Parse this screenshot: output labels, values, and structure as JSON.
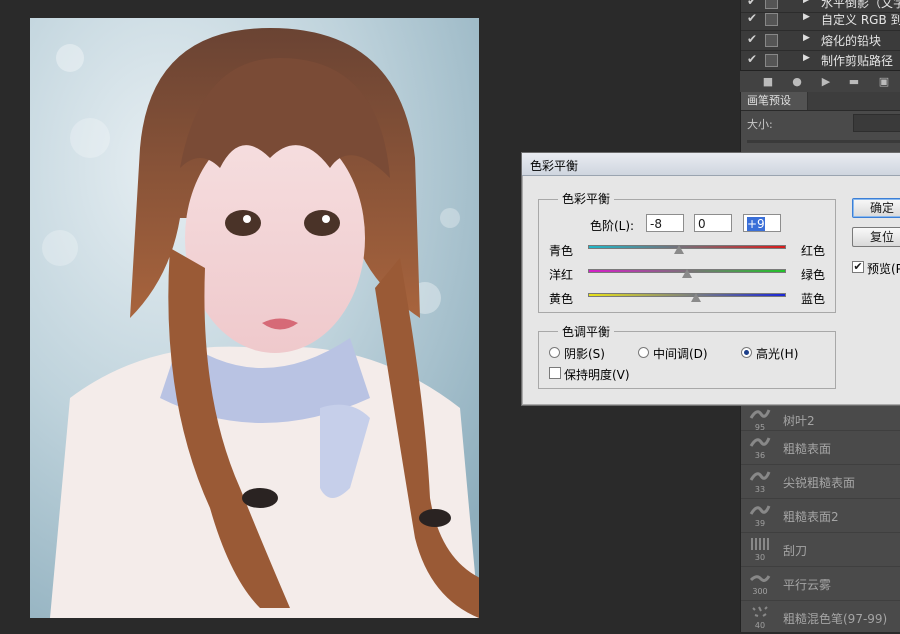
{
  "actions": {
    "rows": [
      {
        "label": "水平倒影（文字",
        "checked": true
      },
      {
        "label": "自定义 RGB 到灰度",
        "checked": true
      },
      {
        "label": "熔化的铅块",
        "checked": true
      },
      {
        "label": "制作剪贴路径",
        "checked": true
      }
    ]
  },
  "brush_panel": {
    "tab": "画笔预设",
    "size_label": "大小:",
    "items": [
      {
        "num": "95",
        "name": "树叶2"
      },
      {
        "num": "36",
        "name": "粗糙表面"
      },
      {
        "num": "33",
        "name": "尖锐粗糙表面"
      },
      {
        "num": "39",
        "name": "粗糙表面2"
      },
      {
        "num": "30",
        "name": "刮刀"
      },
      {
        "num": "300",
        "name": "平行云雾"
      },
      {
        "num": "40",
        "name": "粗糙混色笔(97-99)"
      }
    ]
  },
  "dialog": {
    "title": "色彩平衡",
    "color_balance": {
      "group_title": "色彩平衡",
      "levels_label": "色阶(L):",
      "levels": [
        "-8",
        "0",
        "+9"
      ],
      "sliders": [
        {
          "left": "青色",
          "right": "红色",
          "value": -8,
          "colors": [
            "#1fb7c9",
            "#d91c1c"
          ]
        },
        {
          "left": "洋红",
          "right": "绿色",
          "value": 0,
          "colors": [
            "#d51fc8",
            "#22c22a"
          ]
        },
        {
          "left": "黄色",
          "right": "蓝色",
          "value": 9,
          "colors": [
            "#e8e21a",
            "#1a27d8"
          ]
        }
      ]
    },
    "tone_balance": {
      "group_title": "色调平衡",
      "options": [
        "阴影(S)",
        "中间调(D)",
        "高光(H)"
      ],
      "selected": "高光(H)",
      "preserve_luminosity": "保持明度(V)"
    },
    "buttons": {
      "ok": "确定",
      "reset": "复位"
    },
    "preview_label": "预览(P)",
    "preview_checked": true
  }
}
